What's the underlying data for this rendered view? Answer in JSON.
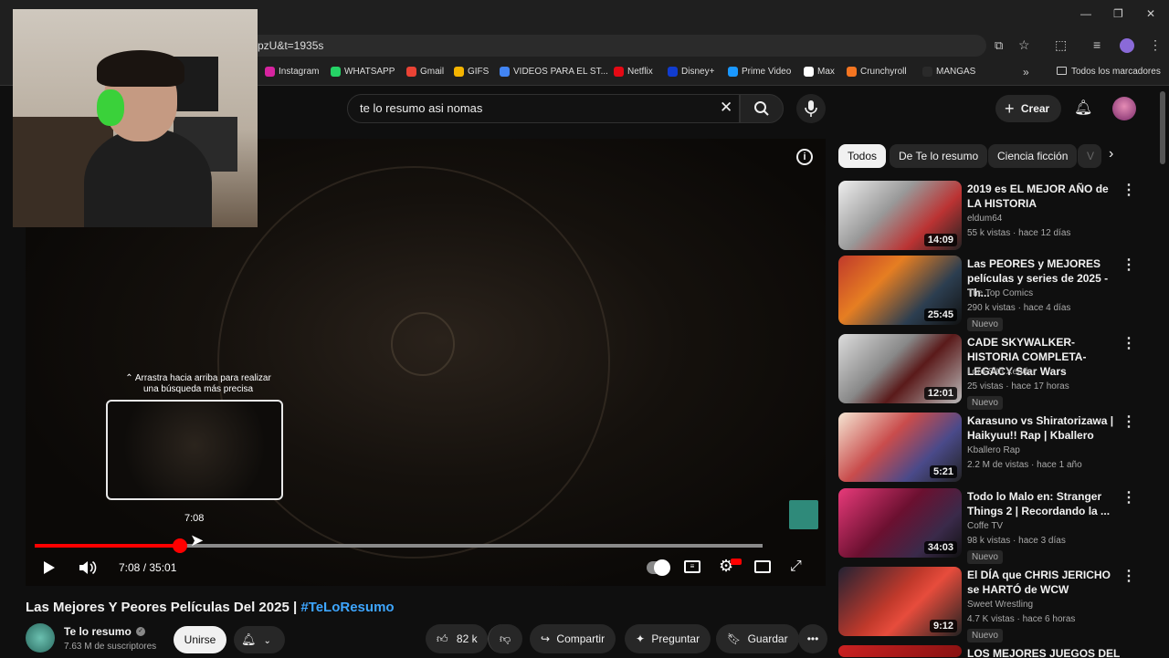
{
  "browser": {
    "url": "pzU&t=1935s",
    "bookmarks": [
      {
        "label": "Instagram",
        "color": "#d6249f"
      },
      {
        "label": "WHATSAPP",
        "color": "#25d366"
      },
      {
        "label": "Gmail",
        "color": "#ea4335"
      },
      {
        "label": "GIFS",
        "color": "#f4b400"
      },
      {
        "label": "VIDEOS PARA EL ST...",
        "color": "#4285f4"
      },
      {
        "label": "Netflix",
        "color": "#e50914"
      },
      {
        "label": "Disney+",
        "color": "#113ccf"
      },
      {
        "label": "Prime Video",
        "color": "#1a98ff"
      },
      {
        "label": "Max",
        "color": "#ffffff"
      },
      {
        "label": "Crunchyroll",
        "color": "#f47521"
      },
      {
        "label": "MANGAS",
        "color": "#2a2a2a"
      }
    ],
    "all_bookmarks": "Todos los marcadores"
  },
  "youtube": {
    "search_value": "te lo resumo asi nomas",
    "create_label": "Crear"
  },
  "player": {
    "drag_hint": "⌃ Arrastra hacia arriba para realizar una búsqueda más precisa",
    "hover_time": "7:08",
    "time_display": "7:08 / 35:01",
    "progress_fraction": 0.2
  },
  "video": {
    "title": "Las Mejores Y Peores Películas Del 2025 | ",
    "hashtag": "#TeLoResumo",
    "channel": "Te lo resumo",
    "subscribers": "7.63 M de suscriptores",
    "join_label": "Unirse",
    "likes": "82 k",
    "share_label": "Compartir",
    "ask_label": "Preguntar",
    "save_label": "Guardar"
  },
  "chips": [
    "Todos",
    "De Te lo resumo",
    "Ciencia ficción",
    "V"
  ],
  "recommendations": [
    {
      "title": "2019 es EL MEJOR AÑO de LA HISTORIA",
      "channel": "eldum64",
      "meta": "55 k vistas · hace 12 días",
      "duration": "14:09",
      "badge": "",
      "bg": "linear-gradient(135deg,#eee 0%,#999 40%,#b33 70%,#222 100%)"
    },
    {
      "title": "Las PEORES y MEJORES películas y series de 2025 - Th...",
      "channel": "The Top Comics",
      "meta": "290 k vistas · hace 4 días",
      "duration": "25:45",
      "badge": "Nuevo",
      "bg": "linear-gradient(135deg,#c0392b 0%,#e67e22 35%,#2c3e50 70%,#111 100%)"
    },
    {
      "title": "CADE SKYWALKER-HISTORIA COMPLETA-LEGACY Star Wars",
      "channel": "Lord Sith Xendor",
      "meta": "25 vistas · hace 17 horas",
      "duration": "12:01",
      "badge": "Nuevo",
      "bg": "linear-gradient(135deg,#ddd 0%,#888 40%,#5a1a1a 60%,#bbb 100%)"
    },
    {
      "title": "Karasuno vs Shiratorizawa | Haikyuu!! Rap | Kballero",
      "channel": "Kballero Rap",
      "meta": "2.2 M de vistas · hace 1 año",
      "duration": "5:21",
      "badge": "",
      "bg": "linear-gradient(135deg,#f5e6d3 0%,#c94c4c 40%,#4a4a8a 70%,#222 100%)"
    },
    {
      "title": "Todo lo Malo en: Stranger Things 2 | Recordando la ...",
      "channel": "Coffe TV",
      "meta": "98 k vistas · hace 3 días",
      "duration": "34:03",
      "badge": "Nuevo",
      "bg": "linear-gradient(135deg,#e83a7a 0%,#6b1030 45%,#3a2a4a 75%,#111 100%)"
    },
    {
      "title": "El DÍA que CHRIS JERICHO se HARTÓ de WCW",
      "channel": "Sweet Wrestling",
      "meta": "4.7 K vistas · hace 6 horas",
      "duration": "9:12",
      "badge": "Nuevo",
      "bg": "linear-gradient(135deg,#223 0%,#c0392b 45%,#e74c3c 60%,#222 100%)"
    },
    {
      "title": "LOS MEJORES JUEGOS DEL",
      "channel": "",
      "meta": "",
      "duration": "",
      "badge": "",
      "bg": "linear-gradient(135deg,#c22 0%,#811 100%)"
    }
  ]
}
